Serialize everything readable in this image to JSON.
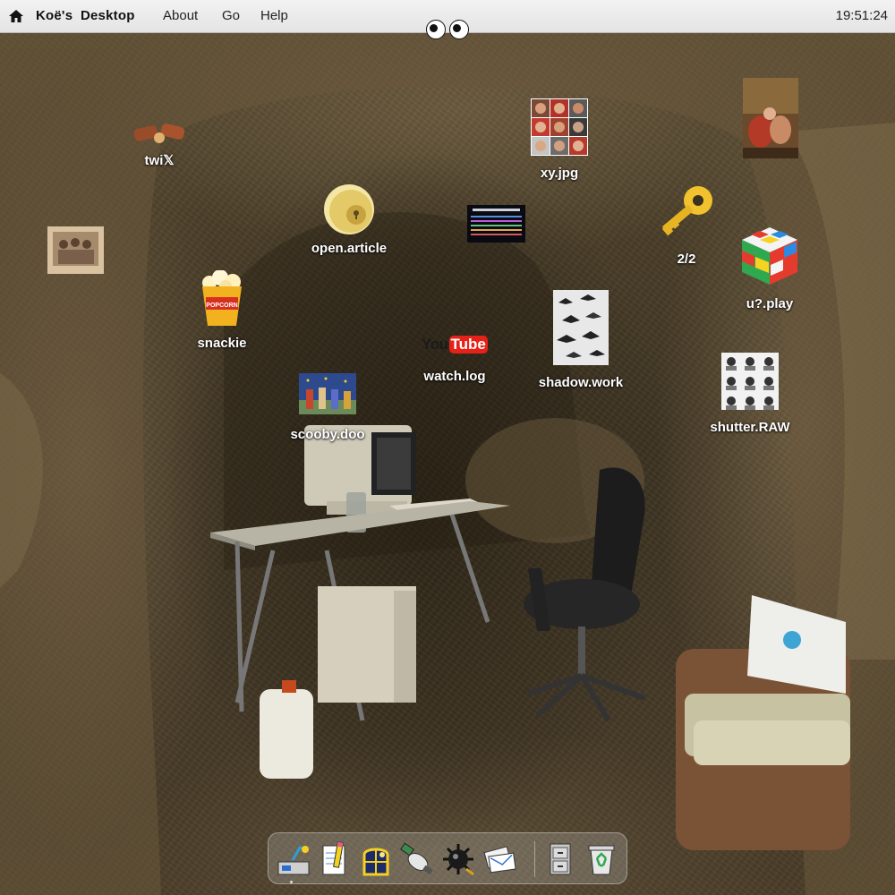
{
  "menubar": {
    "home_icon": "home-icon",
    "title": "Koë's  Desktop",
    "menus": [
      "About",
      "Go",
      "Help"
    ],
    "clock": "19:51:24"
  },
  "desktop_icons": [
    {
      "label": "twi𝕏",
      "icon": "candy-bar-icon"
    },
    {
      "label": "open.article",
      "icon": "door-knob-icon"
    },
    {
      "label": "xy.jpg",
      "icon": "portrait-grid-thumbnail"
    },
    {
      "label": "2/2",
      "icon": "gold-key-icon"
    },
    {
      "label": "u?.play",
      "icon": "rubiks-cube-icon"
    },
    {
      "label": "snackie",
      "icon": "popcorn-icon"
    },
    {
      "label": "watch.log",
      "icon": "youtube-logo"
    },
    {
      "label": "shadow.work",
      "icon": "birds-sketch-thumbnail"
    },
    {
      "label": "scooby.doo",
      "icon": "painting-thumbnail"
    },
    {
      "label": "shutter.RAW",
      "icon": "photo-grid-thumbnail"
    },
    {
      "label": "",
      "icon": "old-photo-thumbnail"
    },
    {
      "label": "",
      "icon": "alphabet-chart-thumbnail"
    },
    {
      "label": "",
      "icon": "classical-painting-thumbnail"
    }
  ],
  "youtube": {
    "you": "You",
    "tube": "Tube"
  },
  "popcorn_text": "POPCORN",
  "colors": {
    "menubar": "#ececec",
    "label_text": "#ffffff",
    "cave": "#4a3f2c",
    "youtube_red": "#e62117"
  },
  "dock": {
    "items": [
      "control-panel-icon",
      "notepad-icon",
      "night-window-icon",
      "satellite-icon",
      "virus-icon",
      "mail-icon",
      "file-cabinet-icon",
      "recycle-bin-icon"
    ]
  }
}
